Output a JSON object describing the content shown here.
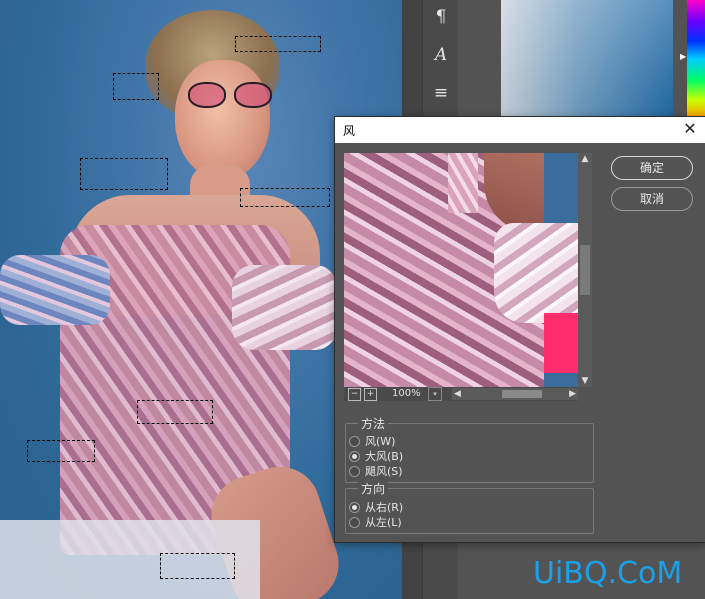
{
  "side_panel": {
    "items": [
      {
        "icon": "paragraph-icon",
        "glyph": "¶"
      },
      {
        "icon": "character-icon",
        "glyph": "A"
      },
      {
        "icon": "adjustments-icon",
        "glyph": "≡"
      }
    ]
  },
  "dialog": {
    "title": "风",
    "close_glyph": "✕",
    "ok_label": "确定",
    "cancel_label": "取消",
    "preview": {
      "zoom": "100%",
      "zoom_out_glyph": "−",
      "zoom_in_glyph": "+",
      "scroll_up_glyph": "▲",
      "scroll_down_glyph": "▼",
      "scroll_left_glyph": "◀",
      "scroll_right_glyph": "▶",
      "dropdown_glyph": "▾"
    },
    "method": {
      "title": "方法",
      "options": [
        {
          "label": "风(W)",
          "selected": false
        },
        {
          "label": "大风(B)",
          "selected": true
        },
        {
          "label": "飓风(S)",
          "selected": false
        }
      ]
    },
    "direction": {
      "title": "方向",
      "options": [
        {
          "label": "从右(R)",
          "selected": true
        },
        {
          "label": "从左(L)",
          "selected": false
        }
      ]
    }
  },
  "watermark": "UiBQ.CoM",
  "colors": {
    "panel_bg": "#535353",
    "dialog_titlebar": "#ffffff",
    "watermark": "#1ba0e8"
  }
}
